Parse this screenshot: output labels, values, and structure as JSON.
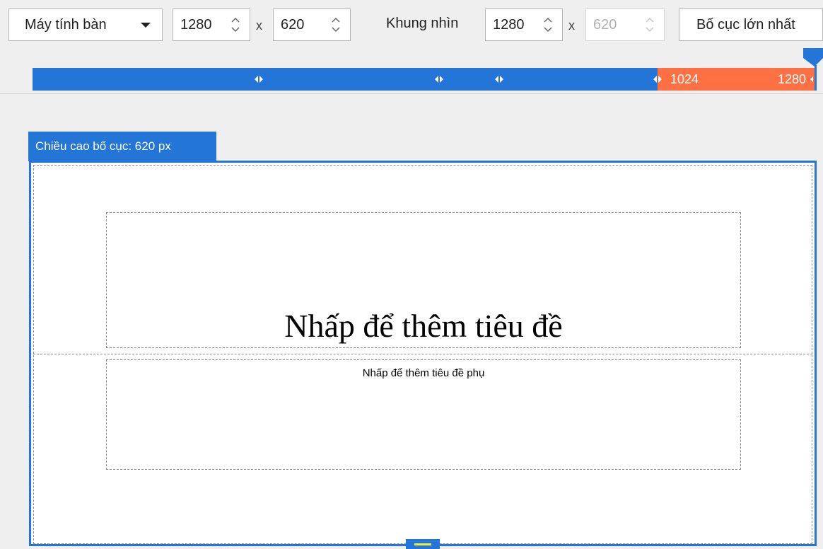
{
  "toolbar": {
    "device": {
      "label": "Máy tính bàn"
    },
    "layout_width": "1280",
    "x_separator": "x",
    "layout_height": "620",
    "viewport_label": "Khung nhìn",
    "viewport_width": "1280",
    "viewport_height": "620",
    "largest_button": "Bố cục lớn nhất"
  },
  "ruler": {
    "range_low": "1024",
    "range_high": "1280",
    "colors": {
      "default": "#2375d8",
      "active": "#ff7043"
    }
  },
  "canvas": {
    "height_tab": "Chiều cao bố cục: 620 px",
    "title_placeholder": "Nhấp để thêm tiêu đề",
    "subtitle_placeholder": "Nhấp để thêm tiêu đề phụ"
  },
  "icons": {
    "device_dropdown": "chevron-down-icon",
    "spinner": "spinner-arrows-icon",
    "breakpoint": "breakpoint-handle-icon",
    "pointer": "breakpoint-pointer-icon",
    "resize": "resize-grip-icon"
  }
}
